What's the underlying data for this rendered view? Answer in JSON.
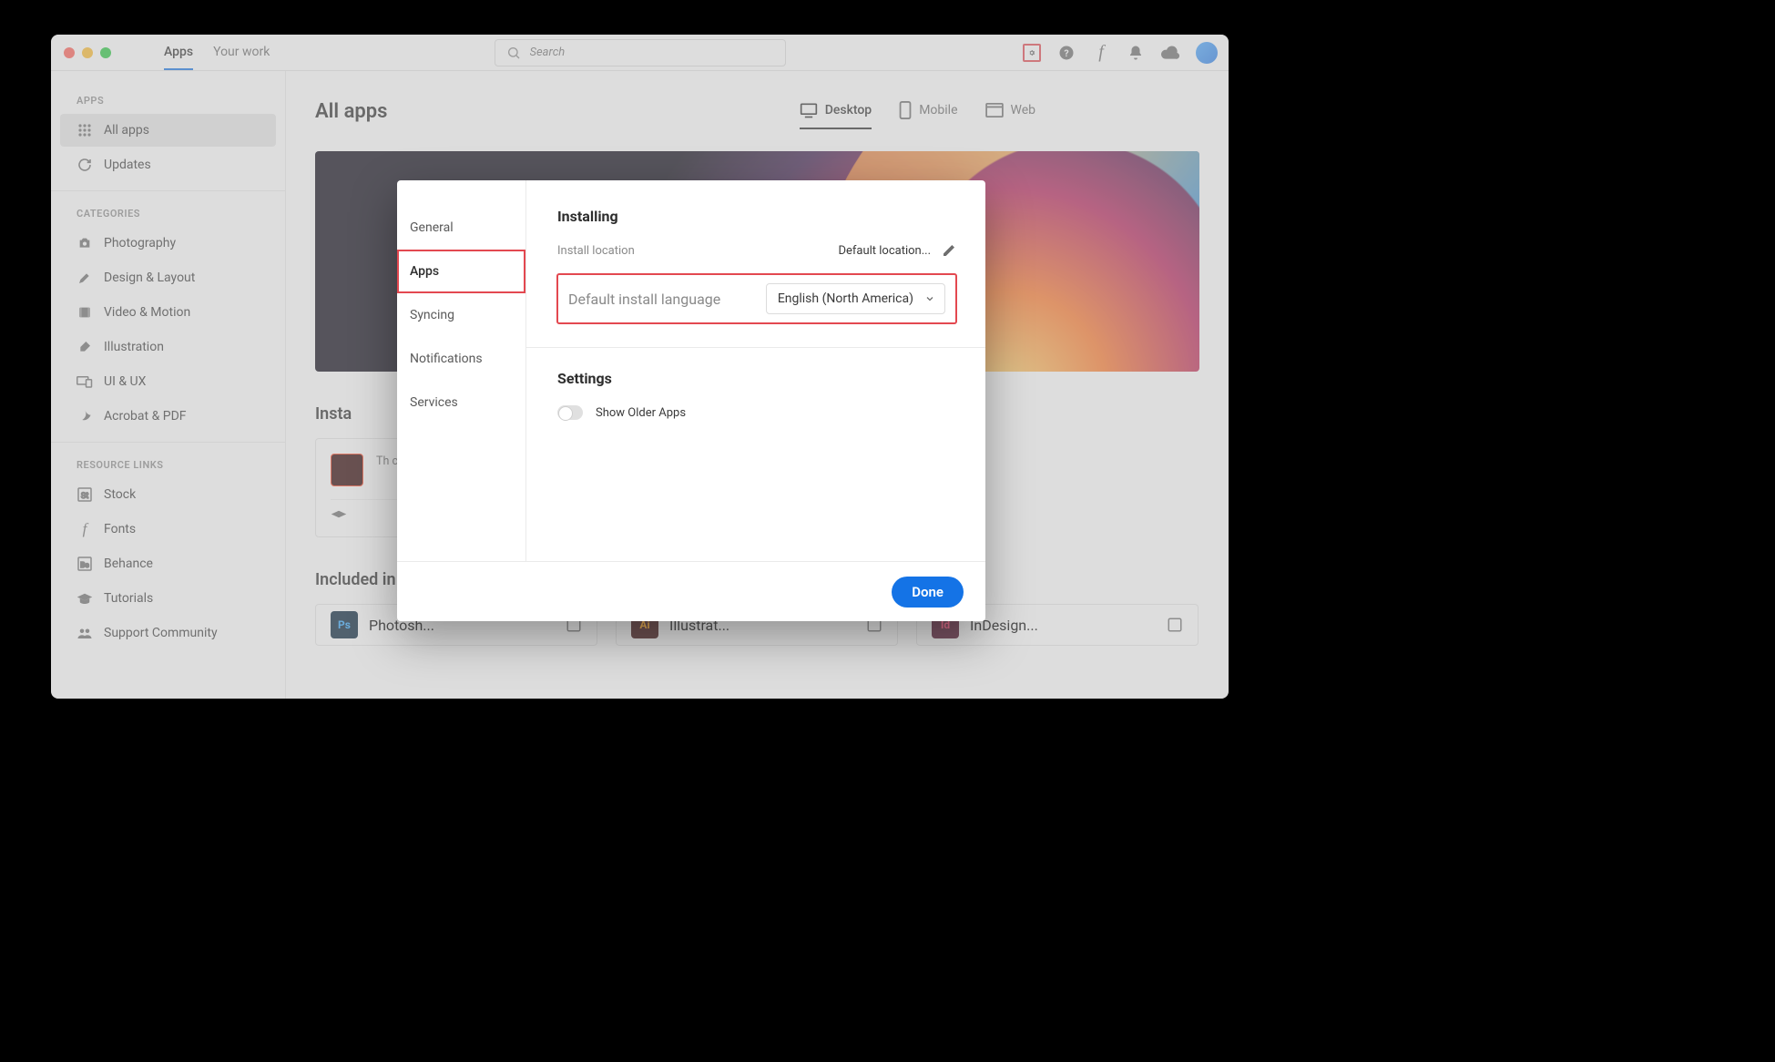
{
  "top": {
    "tabs": [
      "Apps",
      "Your work"
    ],
    "active_tab_index": 0,
    "search_placeholder": "Search"
  },
  "sidebar": {
    "groups": [
      {
        "heading": "APPS",
        "items": [
          {
            "icon": "grid-icon",
            "label": "All apps",
            "active": true
          },
          {
            "icon": "refresh-icon",
            "label": "Updates"
          }
        ]
      },
      {
        "heading": "CATEGORIES",
        "items": [
          {
            "icon": "camera-icon",
            "label": "Photography"
          },
          {
            "icon": "pen-nib-icon",
            "label": "Design & Layout"
          },
          {
            "icon": "film-icon",
            "label": "Video & Motion"
          },
          {
            "icon": "brush-icon",
            "label": "Illustration"
          },
          {
            "icon": "devices-icon",
            "label": "UI & UX"
          },
          {
            "icon": "acrobat-icon",
            "label": "Acrobat & PDF"
          }
        ]
      },
      {
        "heading": "RESOURCE LINKS",
        "items": [
          {
            "icon": "stock-icon",
            "label": "Stock"
          },
          {
            "icon": "fonts-icon",
            "label": "Fonts"
          },
          {
            "icon": "behance-icon",
            "label": "Behance"
          },
          {
            "icon": "grad-cap-icon",
            "label": "Tutorials"
          },
          {
            "icon": "people-icon",
            "label": "Support Community"
          }
        ]
      }
    ]
  },
  "main": {
    "title": "All apps",
    "platform_tabs": [
      {
        "icon": "desktop-icon",
        "label": "Desktop",
        "active": true
      },
      {
        "icon": "mobile-icon",
        "label": "Mobile"
      },
      {
        "icon": "web-icon",
        "label": "Web"
      }
    ],
    "installed_heading": "Insta",
    "installed_card_text": "Th\nco",
    "included_heading": "Included in your subscription",
    "sub_apps": [
      {
        "code": "Ps",
        "bg": "#001e36",
        "fg": "#31a8ff",
        "name": "Photosh..."
      },
      {
        "code": "Ai",
        "bg": "#330000",
        "fg": "#ff9a00",
        "name": "Illustrat..."
      },
      {
        "code": "Id",
        "bg": "#49021f",
        "fg": "#ff3366",
        "name": "InDesign..."
      }
    ]
  },
  "modal": {
    "side": [
      "General",
      "Apps",
      "Syncing",
      "Notifications",
      "Services"
    ],
    "side_active_index": 1,
    "installing_heading": "Installing",
    "install_location_label": "Install location",
    "install_location_value": "Default location...",
    "default_lang_label": "Default install language",
    "default_lang_value": "English (North America)",
    "settings_heading": "Settings",
    "show_older_label": "Show Older Apps",
    "done_label": "Done"
  }
}
